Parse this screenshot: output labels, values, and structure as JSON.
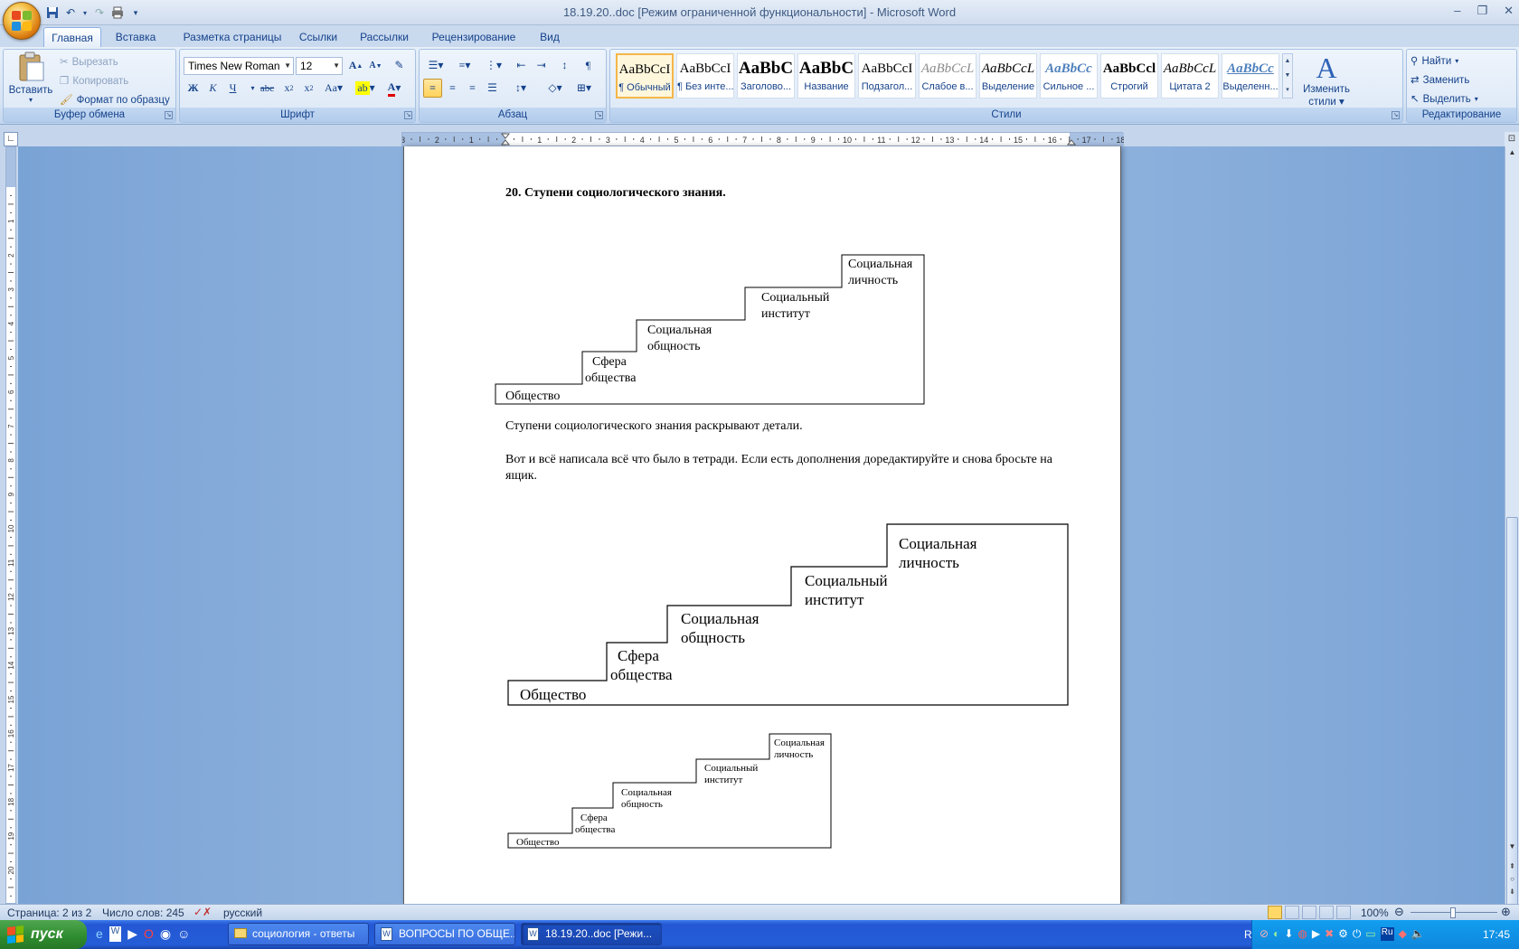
{
  "window": {
    "title": "18.19.20..doc [Режим ограниченной функциональности] - Microsoft Word"
  },
  "tabs": [
    "Главная",
    "Вставка",
    "Разметка страницы",
    "Ссылки",
    "Рассылки",
    "Рецензирование",
    "Вид"
  ],
  "clipboard": {
    "paste_label": "Вставить",
    "cut_label": "Вырезать",
    "copy_label": "Копировать",
    "format_painter_label": "Формат по образцу",
    "group_label": "Буфер обмена"
  },
  "font": {
    "font_name": "Times New Roman",
    "font_size": "12",
    "group_label": "Шрифт",
    "bold": "Ж",
    "italic": "К",
    "underline": "Ч"
  },
  "paragraph": {
    "group_label": "Абзац"
  },
  "styles": {
    "group_label": "Стили",
    "items": [
      {
        "sample": "AaBbCcI",
        "name": "¶ Обычный"
      },
      {
        "sample": "AaBbCcI",
        "name": "¶ Без инте..."
      },
      {
        "sample": "AaBbC",
        "name": "Заголово..."
      },
      {
        "sample": "AaBbC",
        "name": "Название"
      },
      {
        "sample": "AaBbCcI",
        "name": "Подзагол..."
      },
      {
        "sample": "AaBbCcL",
        "name": "Слабое в..."
      },
      {
        "sample": "AaBbCcL",
        "name": "Выделение"
      },
      {
        "sample": "AaBbCc",
        "name": "Сильное ..."
      },
      {
        "sample": "AaBbCcl",
        "name": "Строгий"
      },
      {
        "sample": "AaBbCcL",
        "name": "Цитата 2"
      },
      {
        "sample": "AaBbCc",
        "name": "Выделенн..."
      }
    ],
    "change_styles_label_1": "Изменить",
    "change_styles_label_2": "стили"
  },
  "editing": {
    "group_label": "Редактирование",
    "find_label": "Найти",
    "replace_label": "Заменить",
    "select_label": "Выделить"
  },
  "document": {
    "heading": "20. Ступени социологического  знания.",
    "paragraph1": "Ступени социологического знания раскрывают детали.",
    "paragraph2": "Вот и всё написала всё что было в тетради. Если есть дополнения доредактируйте и снова бросьте на ящик.",
    "steps": [
      {
        "line1": "Общество",
        "line2": ""
      },
      {
        "line1": "Сфера",
        "line2": "общества"
      },
      {
        "line1": "Социальная",
        "line2": "общность"
      },
      {
        "line1": "Социальный",
        "line2": "институт"
      },
      {
        "line1": "Социальная",
        "line2": "личность"
      }
    ]
  },
  "status": {
    "page": "Страница: 2 из 2",
    "words": "Число слов: 245",
    "language": "русский",
    "zoom": "100%"
  },
  "taskbar": {
    "start_label": "пуск",
    "items": [
      {
        "label": "социология - ответы"
      },
      {
        "label": "ВОПРОСЫ ПО ОБЩЕ..."
      },
      {
        "label": "18.19.20..doc [Режи..."
      }
    ],
    "lang": "RL",
    "clock": "17:45"
  }
}
